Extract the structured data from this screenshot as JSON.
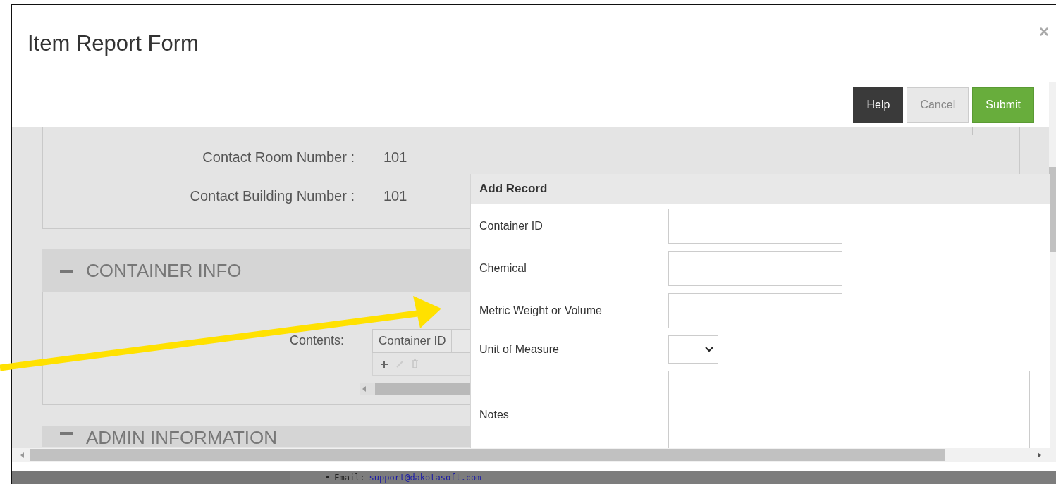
{
  "dialog": {
    "title": "Item Report Form",
    "close_label": "×"
  },
  "toolbar": {
    "buttons": [
      {
        "label": "Help",
        "kind": "help"
      },
      {
        "label": "Cancel",
        "kind": "cancel"
      },
      {
        "label": "Submit",
        "kind": "submit"
      }
    ]
  },
  "contact_fields": [
    {
      "label": "Contact Room Number :",
      "value": "101"
    },
    {
      "label": "Contact Building Number :",
      "value": "101"
    }
  ],
  "sections": [
    {
      "title": "CONTAINER INFO",
      "expanded": true,
      "contents_label": "Contents:",
      "columns": [
        "Container ID"
      ]
    },
    {
      "title": "ADMIN INFORMATION",
      "expanded": true
    }
  ],
  "add_record": {
    "title": "Add Record",
    "fields": [
      {
        "label": "Container ID",
        "kind": "text"
      },
      {
        "label": "Chemical",
        "kind": "text"
      },
      {
        "label": "Metric Weight or Volume",
        "kind": "text"
      },
      {
        "label": "Unit of Measure",
        "kind": "select"
      },
      {
        "label": "Notes",
        "kind": "textarea"
      }
    ]
  },
  "background_page": {
    "bullet": "•",
    "email_label": "Email:",
    "email_link": "support@dakotasoft.com"
  }
}
